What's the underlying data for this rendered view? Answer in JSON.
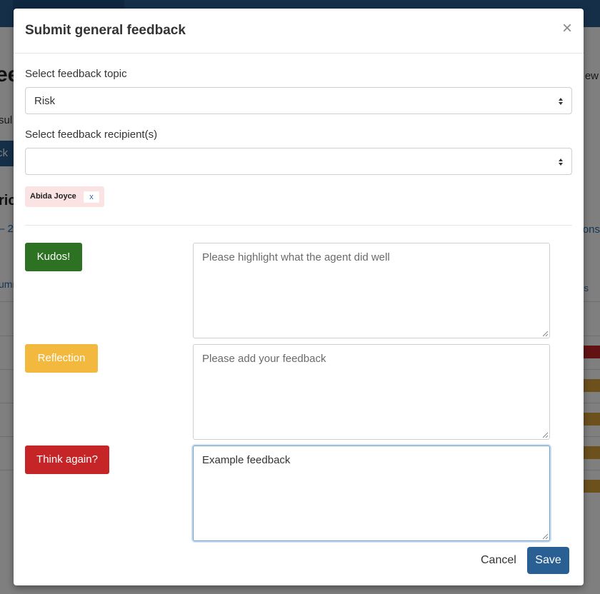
{
  "background": {
    "title_fragment": "ee",
    "subtitle_fragment": "sul",
    "button_fragment": "ck",
    "heading_fragment": "ric",
    "range_fragment": "– 2",
    "column_fragment": "umm",
    "right_new_fragment": "ew",
    "right_ons_fragment": "ons",
    "right_s_fragment": "s",
    "status_colors": [
      "#c62527",
      "#d9a33a",
      "#d9a33a",
      "#d9a33a",
      "#d9a33a"
    ]
  },
  "modal": {
    "title": "Submit general feedback",
    "close_icon": "×",
    "topic": {
      "label": "Select feedback topic",
      "value": "Risk"
    },
    "recipients": {
      "label": "Select feedback recipient(s)",
      "value": "",
      "selected": [
        {
          "name": "Abida Joyce",
          "remove": "x"
        }
      ]
    },
    "sections": [
      {
        "button": "Kudos!",
        "color": "#2d7122",
        "placeholder": "Please highlight what the agent did well",
        "value": ""
      },
      {
        "button": "Reflection",
        "color": "#f2b93e",
        "placeholder": "Please add your feedback",
        "value": ""
      },
      {
        "button": "Think again?",
        "color": "#c62527",
        "placeholder": "",
        "value": "Example feedback"
      }
    ],
    "footer": {
      "cancel": "Cancel",
      "save": "Save"
    }
  }
}
